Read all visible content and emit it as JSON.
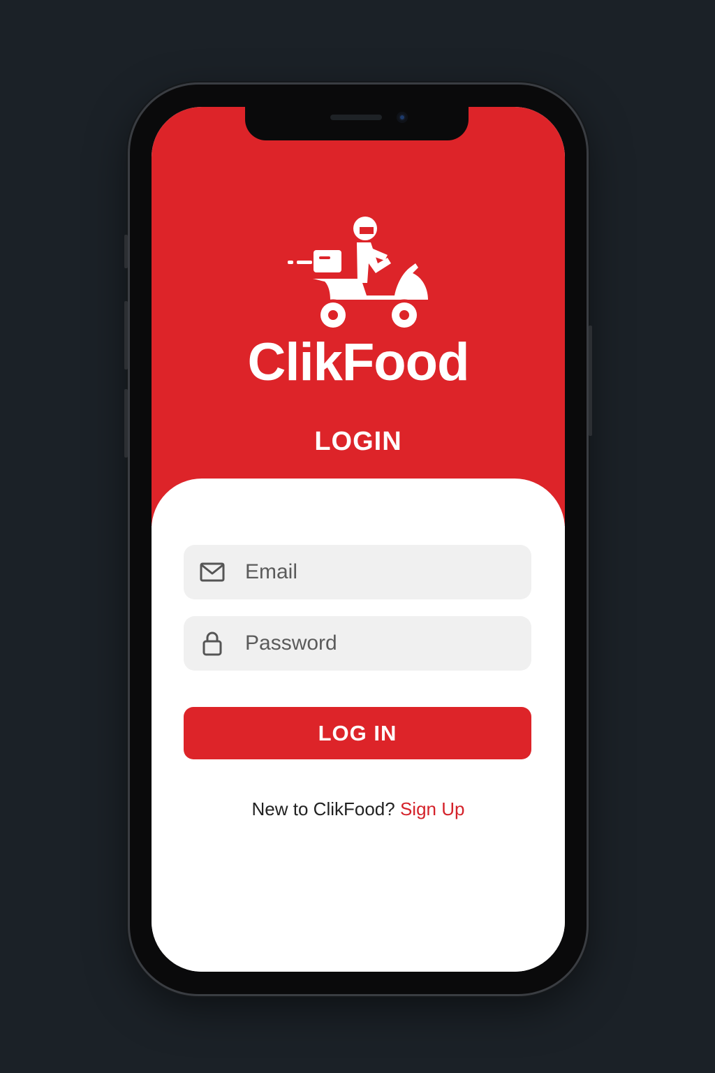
{
  "app": {
    "brand_name": "ClikFood",
    "screen_title": "LOGIN"
  },
  "form": {
    "email": {
      "placeholder": "Email",
      "value": "",
      "icon": "mail-icon"
    },
    "password": {
      "placeholder": "Password",
      "value": "",
      "icon": "lock-icon"
    },
    "submit_label": "LOG IN"
  },
  "footer": {
    "prompt": "New to ClikFood?",
    "signup_label": "Sign Up"
  },
  "colors": {
    "brand_red": "#dd2429",
    "background": "#1b2127",
    "field_bg": "#f0f0f0"
  }
}
